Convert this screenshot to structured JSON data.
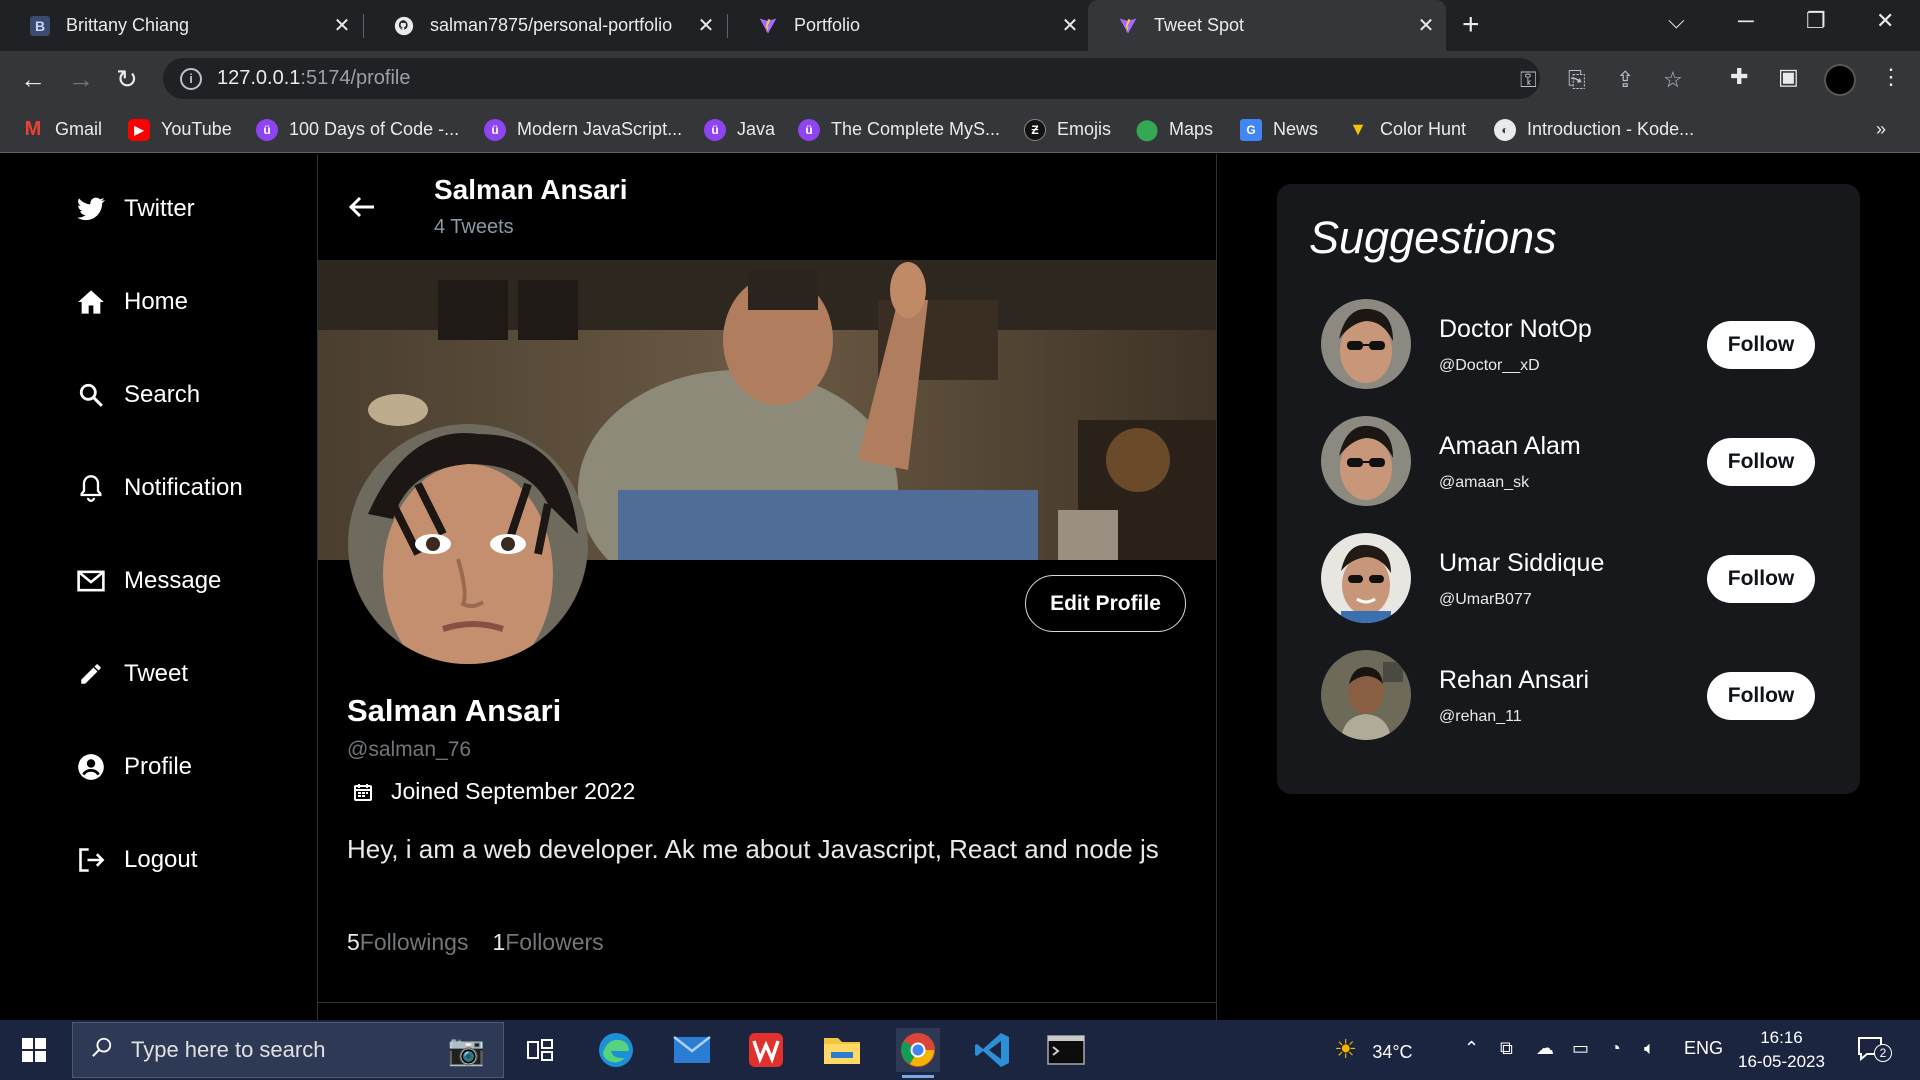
{
  "browser": {
    "tabs": [
      {
        "title": "Brittany Chiang",
        "icon": "B"
      },
      {
        "title": "salman7875/personal-portfolio",
        "icon": "github-icon"
      },
      {
        "title": "Portfolio",
        "icon": "vite-icon"
      },
      {
        "title": "Tweet Spot",
        "icon": "vite-icon"
      }
    ],
    "url_host": "127.0.0.1",
    "url_path": ":5174/profile",
    "bookmarks": [
      {
        "label": "Gmail",
        "color": "#ea4335"
      },
      {
        "label": "YouTube",
        "color": "#ff0000"
      },
      {
        "label": "100 Days of Code -...",
        "color": "#8e44ef"
      },
      {
        "label": "Modern JavaScript...",
        "color": "#8e44ef"
      },
      {
        "label": "Java",
        "color": "#8e44ef"
      },
      {
        "label": "The Complete MyS...",
        "color": "#8e44ef"
      },
      {
        "label": "Emojis",
        "color": "#ffffff"
      },
      {
        "label": "Maps",
        "color": "#34a853"
      },
      {
        "label": "News",
        "color": "#4285f4"
      },
      {
        "label": "Color Hunt",
        "color": "#f4c20d"
      },
      {
        "label": "Introduction - Kode...",
        "color": "#e8eaed"
      }
    ],
    "more_bookmarks": "»"
  },
  "sidebar": {
    "items": [
      {
        "label": "Twitter",
        "icon": "twitter-bird-icon"
      },
      {
        "label": "Home",
        "icon": "home-icon"
      },
      {
        "label": "Search",
        "icon": "search-icon"
      },
      {
        "label": "Notification",
        "icon": "bell-icon"
      },
      {
        "label": "Message",
        "icon": "mail-icon"
      },
      {
        "label": "Tweet",
        "icon": "pencil-icon"
      },
      {
        "label": "Profile",
        "icon": "user-circle-icon"
      },
      {
        "label": "Logout",
        "icon": "logout-icon"
      }
    ]
  },
  "profile": {
    "header_name": "Salman Ansari",
    "tweet_count": "4 Tweets",
    "edit_label": "Edit Profile",
    "name": "Salman Ansari",
    "handle": "@salman_76",
    "joined": "Joined September 2022",
    "bio": "Hey, i am a web developer. Ak me about Javascript, React and node js",
    "followings_count": "5",
    "followings_label": "Followings",
    "followers_count": "1",
    "followers_label": "Followers"
  },
  "suggestions": {
    "title": "Suggestions",
    "follow_label": "Follow",
    "items": [
      {
        "name": "Doctor NotOp",
        "handle": "@Doctor__xD"
      },
      {
        "name": "Amaan Alam",
        "handle": "@amaan_sk"
      },
      {
        "name": "Umar Siddique",
        "handle": "@UmarB077"
      },
      {
        "name": "Rehan Ansari",
        "handle": "@rehan_11"
      }
    ]
  },
  "taskbar": {
    "search_placeholder": "Type here to search",
    "weather": "34°C",
    "language": "ENG",
    "time": "16:16",
    "date": "16-05-2023",
    "notification_count": "2"
  }
}
